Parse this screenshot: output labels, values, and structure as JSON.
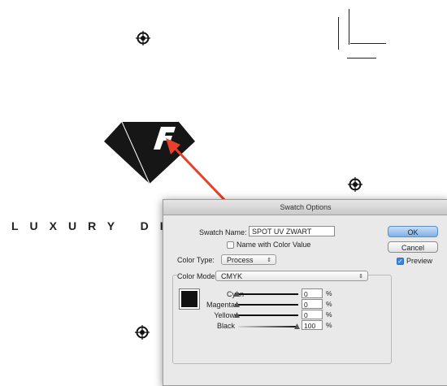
{
  "brand": {
    "text": "LUXURY DI"
  },
  "dialog": {
    "title": "Swatch Options",
    "swatch_name_label": "Swatch Name:",
    "swatch_name_value": "SPOT UV ZWART",
    "name_with_color_value_label": "Name with Color Value",
    "color_type_label": "Color Type:",
    "color_type_value": "Process",
    "color_mode_label": "Color Mode:",
    "color_mode_value": "CMYK",
    "ok_label": "OK",
    "cancel_label": "Cancel",
    "preview_label": "Preview",
    "preview_checked": true,
    "name_with_color_value_checked": false,
    "swatch_color": "#111111",
    "channels": [
      {
        "label": "Cyan",
        "value": "0",
        "unit": "%"
      },
      {
        "label": "Magenta",
        "value": "0",
        "unit": "%"
      },
      {
        "label": "Yellow",
        "value": "0",
        "unit": "%"
      },
      {
        "label": "Black",
        "value": "100",
        "unit": "%"
      }
    ]
  },
  "annotation": {
    "arrow_color": "#e8402a"
  }
}
